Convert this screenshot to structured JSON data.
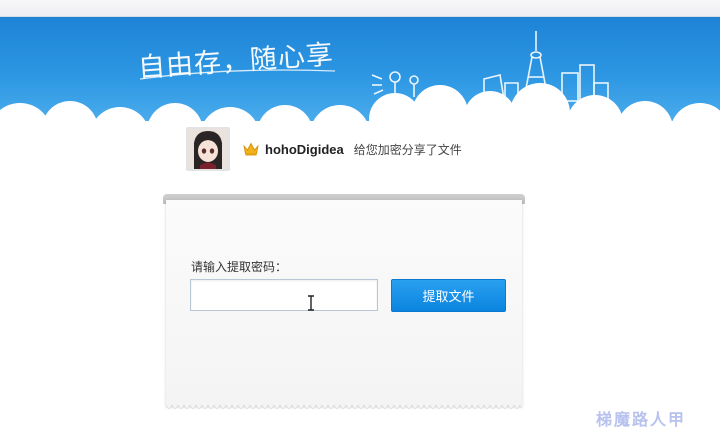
{
  "banner": {
    "slogan": "自由存，随心享"
  },
  "sharer": {
    "username": "hohoDigidea",
    "message": "给您加密分享了文件",
    "badge_icon": "crown-icon"
  },
  "form": {
    "password_label": "请输入提取密码：",
    "password_value": "",
    "submit_label": "提取文件"
  },
  "watermark": "梯魔路人甲",
  "colors": {
    "banner_blue": "#2d97e3",
    "button_blue": "#0b84e0",
    "crown_gold": "#f2b21a"
  }
}
